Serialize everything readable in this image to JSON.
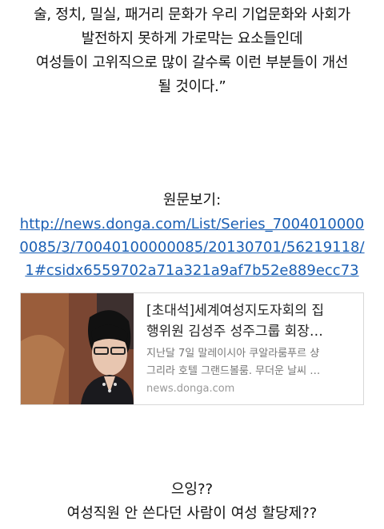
{
  "quote_lines": [
    "술, 정치, 밀실, 패거리 문화가 우리 기업문화와 사회가",
    "발전하지 못하게 가로막는 요소들인데",
    "여성들이 고위직으로 많이 갈수록 이런 부분들이 개선",
    "될 것이다.”"
  ],
  "original_label": "원문보기:",
  "original_link_lines": [
    "http://news.donga.com/List/Series_7004010000",
    "0085/3/70040100000085/20130701/56219118/",
    "1#csidx6559702a71a321a9af7b52e889ecc73"
  ],
  "link_card": {
    "title_lines": [
      "[초대석]세계여성지도자회의 집",
      "행위원 김성주 성주그룹 회장…"
    ],
    "description_lines": [
      "지난달 7일 말레이시아 쿠알라룸푸르 샹",
      "그리라 호텔 그랜드볼룸. 무더운 날씨 …"
    ],
    "source": "news.donga.com"
  },
  "bottom_lines": [
    "으잉??",
    "여성직원 안 쓴다던 사람이 여성 할당제??"
  ]
}
